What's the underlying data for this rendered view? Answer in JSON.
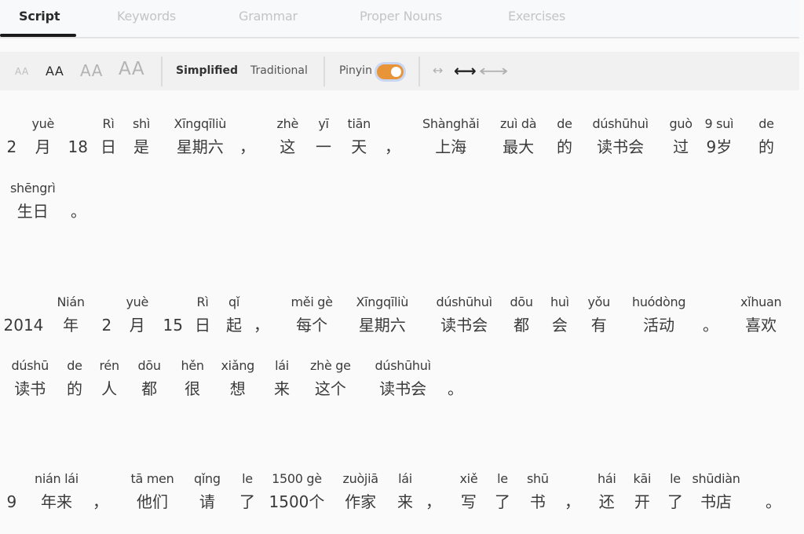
{
  "tabs": [
    {
      "label": "Script",
      "active": true
    },
    {
      "label": "Keywords",
      "active": false
    },
    {
      "label": "Grammar",
      "active": false
    },
    {
      "label": "Proper Nouns",
      "active": false
    },
    {
      "label": "Exercises",
      "active": false
    }
  ],
  "toolbar": {
    "font_sizes": [
      "AA",
      "AA",
      "AA",
      "AA"
    ],
    "font_size_selected_index": 1,
    "script_options": [
      "Simplified",
      "Traditional"
    ],
    "script_selected": "Simplified",
    "pinyin_label": "Pinyin",
    "pinyin_enabled": true,
    "spacing_options": [
      "↔",
      "⟷",
      "⟷"
    ],
    "spacing_selected_index": 1,
    "accent_color": "#e8953a"
  },
  "script": {
    "lines": [
      [
        {
          "py": "",
          "hz": "2"
        },
        {
          "py": "yuè",
          "hz": "月"
        },
        {
          "py": "",
          "hz": "18"
        },
        {
          "py": "Rì",
          "hz": "日"
        },
        {
          "py": "shì",
          "hz": "是"
        },
        {
          "py": "Xīngqīliù",
          "hz": "星期六"
        },
        {
          "py": "",
          "hz": "，"
        },
        {
          "py": "zhè",
          "hz": "这"
        },
        {
          "py": "yī",
          "hz": "一"
        },
        {
          "py": "tiān",
          "hz": "天"
        },
        {
          "py": "",
          "hz": "，"
        },
        {
          "py": "Shànghǎi",
          "hz": "上海"
        },
        {
          "py": "zuì dà",
          "hz": "最大"
        },
        {
          "py": "de",
          "hz": "的"
        },
        {
          "py": "dúshūhuì",
          "hz": "读书会"
        },
        {
          "py": "guò",
          "hz": "过"
        },
        {
          "py": "9 suì",
          "hz": "9岁"
        },
        {
          "py": "de",
          "hz": "的"
        }
      ],
      [
        {
          "py": "shēngrì",
          "hz": "生日"
        },
        {
          "py": "",
          "hz": "。"
        }
      ],
      [
        {
          "py": "",
          "hz": "2014"
        },
        {
          "py": "Nián",
          "hz": "年"
        },
        {
          "py": "",
          "hz": "2"
        },
        {
          "py": "yuè",
          "hz": "月"
        },
        {
          "py": "",
          "hz": "15"
        },
        {
          "py": "Rì",
          "hz": "日"
        },
        {
          "py": "qǐ",
          "hz": "起"
        },
        {
          "py": "",
          "hz": "，"
        },
        {
          "py": "měi gè",
          "hz": "每个"
        },
        {
          "py": "Xīngqīliù",
          "hz": "星期六"
        },
        {
          "py": "dúshūhuì",
          "hz": "读书会"
        },
        {
          "py": "dōu",
          "hz": "都"
        },
        {
          "py": "huì",
          "hz": "会"
        },
        {
          "py": "yǒu",
          "hz": "有"
        },
        {
          "py": "huódòng",
          "hz": "活动"
        },
        {
          "py": "",
          "hz": "。"
        },
        {
          "py": "xǐhuan",
          "hz": "喜欢"
        }
      ],
      [
        {
          "py": "dúshū",
          "hz": "读书"
        },
        {
          "py": "de",
          "hz": "的"
        },
        {
          "py": "rén",
          "hz": "人"
        },
        {
          "py": "dōu",
          "hz": "都"
        },
        {
          "py": "hěn",
          "hz": "很"
        },
        {
          "py": "xiǎng",
          "hz": "想"
        },
        {
          "py": "lái",
          "hz": "来"
        },
        {
          "py": "zhè ge",
          "hz": "这个"
        },
        {
          "py": "dúshūhuì",
          "hz": "读书会"
        },
        {
          "py": "",
          "hz": "。"
        }
      ],
      [
        {
          "py": "",
          "hz": "9"
        },
        {
          "py": "nián lái",
          "hz": "年来"
        },
        {
          "py": "",
          "hz": "，"
        },
        {
          "py": "tā men",
          "hz": "他们"
        },
        {
          "py": "qǐng",
          "hz": "请"
        },
        {
          "py": "le",
          "hz": "了"
        },
        {
          "py": "1500 gè",
          "hz": "1500个"
        },
        {
          "py": "zuòjiā",
          "hz": "作家"
        },
        {
          "py": "lái",
          "hz": "来"
        },
        {
          "py": "",
          "hz": "，"
        },
        {
          "py": "xiě",
          "hz": "写"
        },
        {
          "py": "le",
          "hz": "了"
        },
        {
          "py": "shū",
          "hz": "书"
        },
        {
          "py": "",
          "hz": "，"
        },
        {
          "py": "hái",
          "hz": "还"
        },
        {
          "py": "kāi",
          "hz": "开"
        },
        {
          "py": "le",
          "hz": "了"
        },
        {
          "py": "shūdiàn",
          "hz": "书店"
        },
        {
          "py": "",
          "hz": "。"
        }
      ]
    ]
  }
}
